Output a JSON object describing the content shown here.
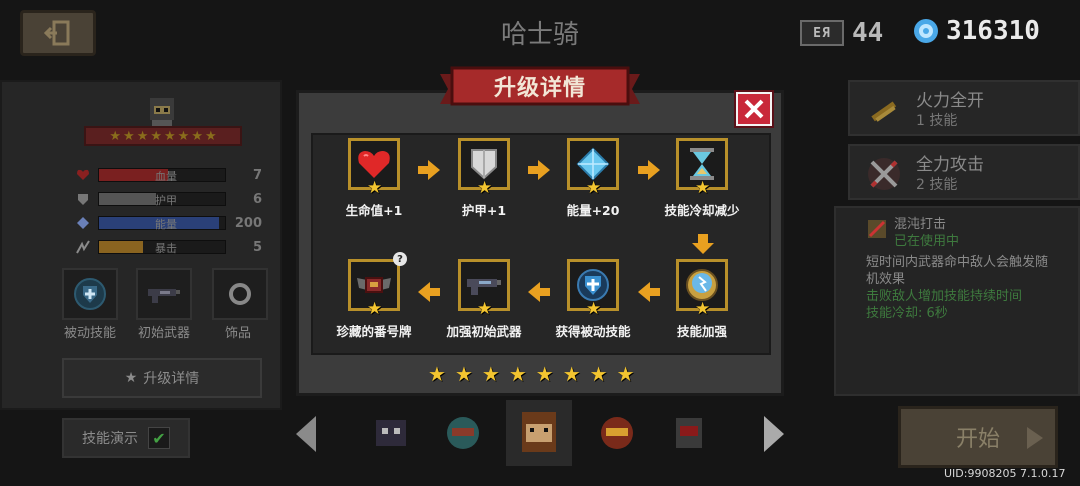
{
  "header": {
    "title": "哈士骑",
    "level_icon_text": "ЕЯ",
    "level_value": "44",
    "gems_value": "316310"
  },
  "left_panel": {
    "stats": [
      {
        "name": "血量",
        "value": "7",
        "icon": "heart-icon",
        "fill": 0.55,
        "color": "#b02a2a"
      },
      {
        "name": "护甲",
        "value": "6",
        "icon": "shield-icon",
        "fill": 0.45,
        "color": "#6e6e6e"
      },
      {
        "name": "能量",
        "value": "200",
        "icon": "energy-icon",
        "fill": 0.95,
        "color": "#3556a8"
      },
      {
        "name": "暴击",
        "value": "5",
        "icon": "crit-icon",
        "fill": 0.35,
        "color": "#b8862a"
      }
    ],
    "slots": [
      "被动技能",
      "初始武器",
      "饰品"
    ],
    "upgrade_button": "升级详情",
    "demo_label": "技能演示"
  },
  "right_panel": {
    "skills": [
      {
        "name": "火力全开",
        "sub": "1 技能"
      },
      {
        "name": "全力攻击",
        "sub": "2 技能"
      }
    ],
    "description": {
      "name": "混沌打击",
      "status": "已在使用中",
      "text": "短时间内武器命中敌人会触发随机效果",
      "green": "击败敌人增加技能持续时间",
      "cooldown": "技能冷却: 6秒"
    },
    "start_button": "开始",
    "uid": "UID:9908205 7.1.0.17"
  },
  "modal": {
    "title": "升级详情",
    "items": [
      {
        "label": "生命值+1",
        "icon": "heart-icon"
      },
      {
        "label": "护甲+1",
        "icon": "armor-shield-icon"
      },
      {
        "label": "能量+20",
        "icon": "energy-crystal-icon"
      },
      {
        "label": "技能冷却减少",
        "icon": "hourglass-icon"
      },
      {
        "label": "技能加强",
        "icon": "skill-orb-icon"
      },
      {
        "label": "获得被动技能",
        "icon": "passive-shield-icon"
      },
      {
        "label": "加强初始武器",
        "icon": "gun-icon"
      },
      {
        "label": "珍藏的番号牌",
        "icon": "winged-badge-icon"
      }
    ],
    "stars_count": 8
  }
}
